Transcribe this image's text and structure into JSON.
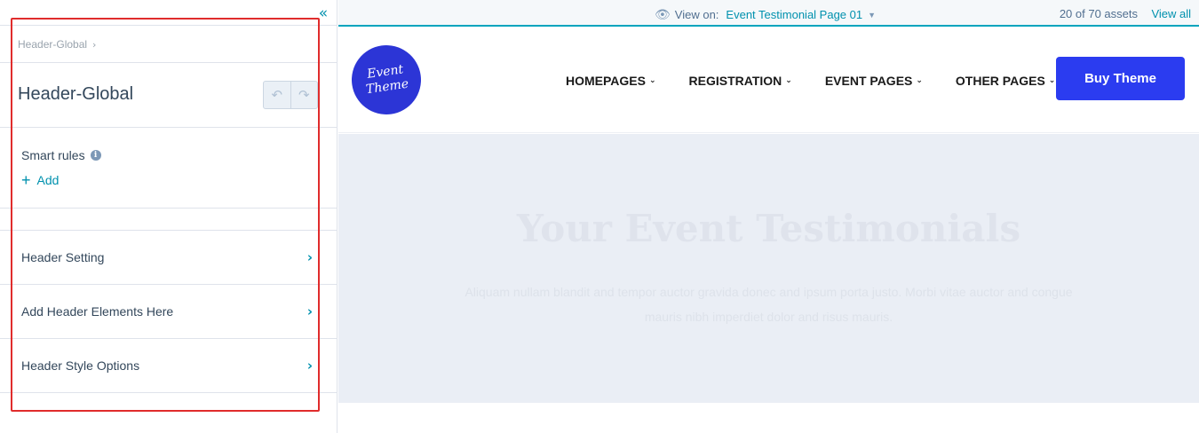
{
  "panel": {
    "collapse_glyph": "«",
    "breadcrumb": "Header-Global",
    "breadcrumb_chevron": "›",
    "title": "Header-Global",
    "undo_glyph": "↶",
    "redo_glyph": "↷",
    "smart_rules_label": "Smart rules",
    "info_glyph": "i",
    "add_plus": "+",
    "add_label": "Add",
    "rows": [
      {
        "label": "Header Setting",
        "chevron": "›"
      },
      {
        "label": "Add Header Elements Here",
        "chevron": "›"
      },
      {
        "label": "Header Style Options",
        "chevron": "›"
      }
    ]
  },
  "topbar": {
    "eye_glyph": "👁",
    "view_on_label": "View on:",
    "page_name": "Event Testimonial Page 01",
    "caret_glyph": "▼",
    "asset_count": "20 of 70 assets",
    "view_all": "View all"
  },
  "preview": {
    "logo_line1": "Event",
    "logo_line2": "Theme",
    "nav": [
      {
        "label": "HOMEPAGES",
        "chevron": "⌄"
      },
      {
        "label": "REGISTRATION",
        "chevron": "⌄"
      },
      {
        "label": "EVENT PAGES",
        "chevron": "⌄"
      },
      {
        "label": "OTHER PAGES",
        "chevron": "⌄"
      }
    ],
    "buy_label": "Buy Theme",
    "hero_title": "Your Event Testimonials",
    "hero_sub": "Aliquam nullam blandit and tempor auctor gravida donec and ipsum porta justo. Morbi vitae auctor and congue mauris nibh imperdiet dolor and risus mauris."
  },
  "colors": {
    "accent": "#0091ae",
    "highlight_border": "#e02c2c",
    "buy_button": "#2b3cf0",
    "logo": "#2c35d6",
    "hero_background": "#eaeef5"
  },
  "icons": {
    "collapse": "double-chevron-left-icon",
    "undo": "undo-icon",
    "redo": "redo-icon",
    "info": "info-icon",
    "add": "plus-icon",
    "row": "chevron-right-icon",
    "view": "eye-icon",
    "dropdown": "caret-down-icon"
  }
}
